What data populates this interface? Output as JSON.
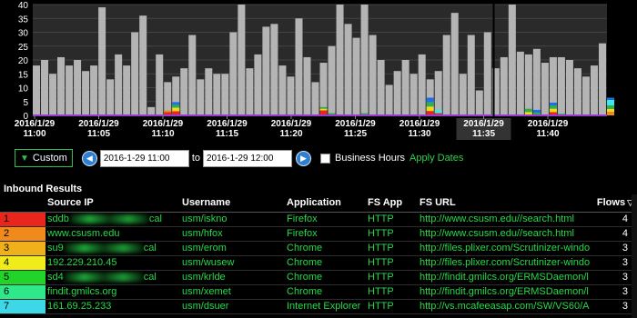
{
  "chart_data": {
    "type": "bar",
    "ylim": [
      0,
      40
    ],
    "yticks": [
      0,
      5,
      10,
      15,
      20,
      25,
      30,
      35,
      40
    ],
    "grid": true,
    "x_tick_labels": [
      {
        "date": "2016/1/29",
        "time": "11:00"
      },
      {
        "date": "2016/1/29",
        "time": "11:05"
      },
      {
        "date": "2016/1/29",
        "time": "11:10"
      },
      {
        "date": "2016/1/29",
        "time": "11:15"
      },
      {
        "date": "2016/1/29",
        "time": "11:20"
      },
      {
        "date": "2016/1/29",
        "time": "11:25"
      },
      {
        "date": "2016/1/29",
        "time": "11:30"
      },
      {
        "date": "2016/1/29",
        "time": "11:35"
      },
      {
        "date": "2016/1/29",
        "time": "11:40"
      }
    ],
    "highlighted_tick": 7,
    "values": [
      18,
      20,
      15,
      21,
      18,
      20,
      16,
      18,
      39,
      13,
      22,
      18,
      30,
      36,
      3,
      22,
      12,
      14,
      17,
      29,
      13,
      17,
      15,
      15,
      30,
      43,
      17,
      22,
      32,
      33,
      18,
      14,
      35,
      21,
      12,
      19,
      25,
      40,
      33,
      28,
      42,
      29,
      20,
      11,
      16,
      20,
      15,
      22,
      13,
      16,
      29,
      37,
      15,
      29,
      9,
      30,
      17,
      21,
      41,
      23,
      22,
      24,
      19,
      21,
      21,
      20,
      17,
      14,
      18,
      26
    ],
    "stacked_segments": [
      {
        "bar": 16,
        "layers": [
          {
            "value": 1.2,
            "color": "#e8261c"
          },
          {
            "value": 0.6,
            "color": "#f08a1c"
          }
        ]
      },
      {
        "bar": 17,
        "layers": [
          {
            "value": 1.5,
            "color": "#e8261c"
          },
          {
            "value": 1.3,
            "color": "#f0d81c"
          },
          {
            "value": 1.0,
            "color": "#2faf4f"
          },
          {
            "value": 1.0,
            "color": "#1c6fe8"
          }
        ]
      },
      {
        "bar": 35,
        "layers": [
          {
            "value": 1.8,
            "color": "#e8261c"
          },
          {
            "value": 0.6,
            "color": "#f0d81c"
          },
          {
            "value": 0.6,
            "color": "#2faf4f"
          }
        ]
      },
      {
        "bar": 36,
        "layers": [
          {
            "value": 0.8,
            "color": "#2faf4f"
          }
        ]
      },
      {
        "bar": 40,
        "layers": [
          {
            "value": 0.8,
            "color": "#2faf4f"
          }
        ]
      },
      {
        "bar": 48,
        "layers": [
          {
            "value": 1.6,
            "color": "#e8261c"
          },
          {
            "value": 1.6,
            "color": "#f0d81c"
          },
          {
            "value": 1.6,
            "color": "#2faf4f"
          },
          {
            "value": 1.6,
            "color": "#1c6fe8"
          }
        ]
      },
      {
        "bar": 49,
        "layers": [
          {
            "value": 0.8,
            "color": "#e8261c"
          },
          {
            "value": 1.2,
            "color": "#3ce8e8"
          }
        ]
      },
      {
        "bar": 60,
        "layers": [
          {
            "value": 1.2,
            "color": "#f0d81c"
          },
          {
            "value": 1.2,
            "color": "#2faf4f"
          }
        ]
      },
      {
        "bar": 61,
        "layers": [
          {
            "value": 1.0,
            "color": "#2faf4f"
          },
          {
            "value": 1.0,
            "color": "#1c6fe8"
          }
        ]
      },
      {
        "bar": 63,
        "layers": [
          {
            "value": 1.2,
            "color": "#e8261c"
          },
          {
            "value": 1.2,
            "color": "#f0d81c"
          },
          {
            "value": 1.2,
            "color": "#2faf4f"
          },
          {
            "value": 1.0,
            "color": "#1c6fe8"
          }
        ]
      },
      {
        "bar": 64,
        "layers": [
          {
            "value": 0.6,
            "color": "#2faf4f"
          }
        ]
      },
      {
        "bar": 70,
        "layers": [
          {
            "value": 1.2,
            "color": "#f08a1c"
          },
          {
            "value": 1.2,
            "color": "#f0d81c"
          },
          {
            "value": 1.2,
            "color": "#2faf4f"
          },
          {
            "value": 2.0,
            "color": "#3ce8e8"
          },
          {
            "value": 0.8,
            "color": "#1c6fe8"
          }
        ]
      },
      {
        "bar": 74,
        "layers": [
          {
            "value": 0.6,
            "color": "#9b3ad0"
          }
        ]
      },
      {
        "bar": 75,
        "layers": [
          {
            "value": 0.6,
            "color": "#9b3ad0"
          }
        ]
      },
      {
        "bar": 76,
        "layers": [
          {
            "value": 0.6,
            "color": "#9b3ad0"
          }
        ]
      },
      {
        "bar": 82,
        "layers": [
          {
            "value": 1.2,
            "color": "#f0d81c"
          }
        ]
      },
      {
        "bar": 83,
        "layers": [
          {
            "value": 1.2,
            "color": "#f0d81c"
          }
        ]
      },
      {
        "bar": 84,
        "layers": [
          {
            "value": 1.2,
            "color": "#f0d81c"
          }
        ]
      },
      {
        "bar": 85,
        "layers": [
          {
            "value": 1.2,
            "color": "#f0d81c"
          },
          {
            "value": 0.8,
            "color": "#2faf4f"
          }
        ]
      }
    ],
    "colors": {
      "bar": "#b4b4b4",
      "plot_bg": "#2a2a2a",
      "grid": "#444444",
      "baseline": "#9b3ad0"
    }
  },
  "controls": {
    "range_label": "Custom",
    "start_date": "2016-1-29 11:00",
    "to_label": "to",
    "end_date": "2016-1-29 12:00",
    "business_hours_label": "Business Hours",
    "apply_label": "Apply Dates"
  },
  "results": {
    "title": "Inbound Results",
    "columns": {
      "source_ip": "Source IP",
      "username": "Username",
      "application": "Application",
      "fs_app": "FS App",
      "fs_url": "FS URL",
      "flows": "Flows"
    },
    "rows": [
      {
        "index": "1",
        "color": "#e8261c",
        "source_prefix": "sddb",
        "source_suffix": "cal",
        "username": "usm/iskno",
        "application": "Firefox",
        "fs_app": "HTTP",
        "fs_url": "http://www.csusm.edu//search.html",
        "flows": "4"
      },
      {
        "index": "2",
        "color": "#f08a1c",
        "source_prefix": "www.csusm.edu",
        "source_suffix": "",
        "username": "usm/hfox",
        "application": "Firefox",
        "fs_app": "HTTP",
        "fs_url": "http://www.csusm.edu//search.html",
        "flows": "4"
      },
      {
        "index": "3",
        "color": "#f0b01c",
        "source_prefix": "su9",
        "source_suffix": "cal",
        "username": "usm/erom",
        "application": "Chrome",
        "fs_app": "HTTP",
        "fs_url": "http://files.plixer.com/Scrutinizer-windo",
        "flows": "3"
      },
      {
        "index": "4",
        "color": "#f0ec1c",
        "source_prefix": "192.229.210.45",
        "source_suffix": "",
        "username": "usm/wusew",
        "application": "Chrome",
        "fs_app": "HTTP",
        "fs_url": "http://files.plixer.com/Scrutinizer-windo",
        "flows": "3"
      },
      {
        "index": "5",
        "color": "#22d42a",
        "source_prefix": "sd4",
        "source_suffix": "cal",
        "username": "usm/krlde",
        "application": "Chrome",
        "fs_app": "HTTP",
        "fs_url": "http://findit.gmilcs.org/ERMSDaemon/l",
        "flows": "3"
      },
      {
        "index": "6",
        "color": "#2fe88a",
        "source_prefix": "findit.gmilcs.org",
        "source_suffix": "",
        "username": "usm/xemet",
        "application": "Chrome",
        "fs_app": "HTTP",
        "fs_url": "http://findit.gmilcs.org/ERMSDaemon/l",
        "flows": "3"
      },
      {
        "index": "7",
        "color": "#3cd8e8",
        "source_prefix": "161.69.25.233",
        "source_suffix": "",
        "username": "usm/dsuer",
        "application": "Internet Explorer",
        "fs_app": "HTTP",
        "fs_url": "http://vs.mcafeeasap.com/SW/VS60/A",
        "flows": "3"
      }
    ]
  }
}
